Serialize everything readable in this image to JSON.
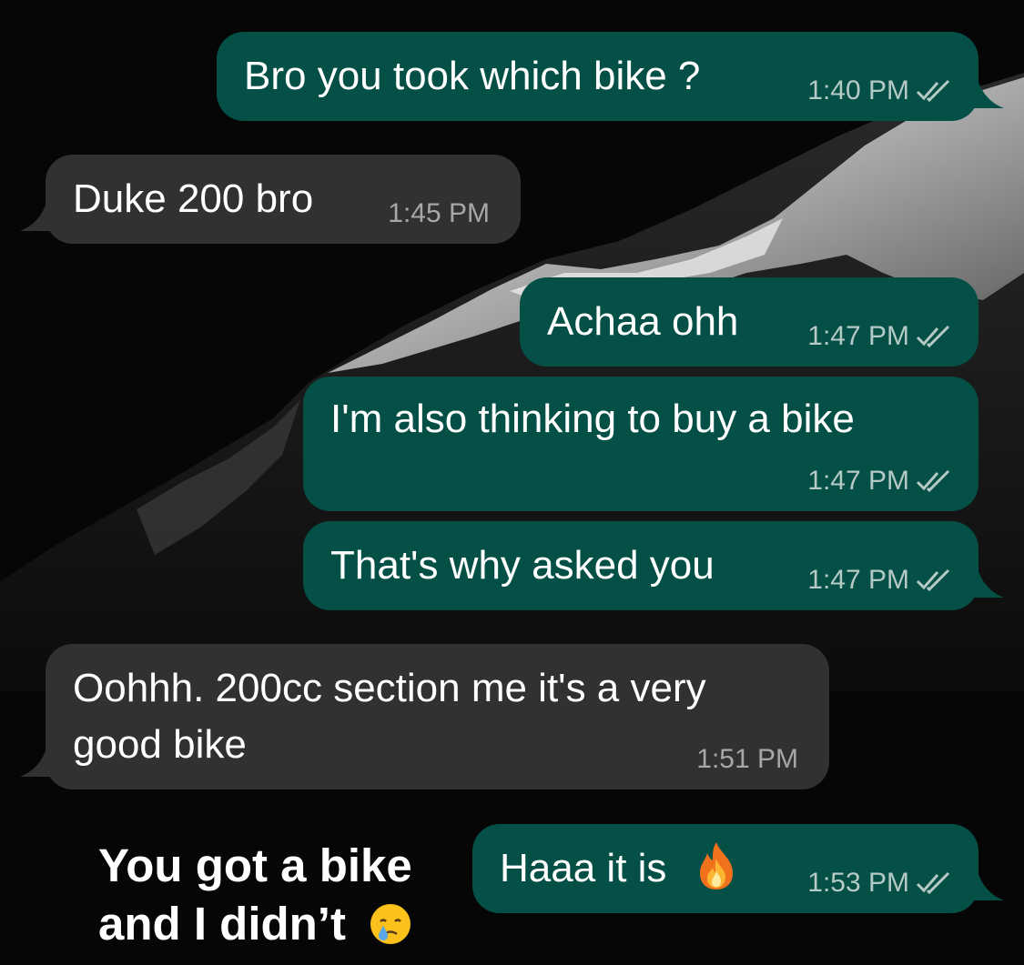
{
  "messages": [
    {
      "text": "Bro you took which bike ?",
      "time": "1:40 PM",
      "direction": "outgoing",
      "status": "read"
    },
    {
      "text": "Duke 200 bro",
      "time": "1:45 PM",
      "direction": "incoming"
    },
    {
      "text": "Achaa ohh",
      "time": "1:47 PM",
      "direction": "outgoing",
      "status": "read"
    },
    {
      "text": "I'm also thinking to buy a bike",
      "time": "1:47 PM",
      "direction": "outgoing",
      "status": "read"
    },
    {
      "text": "That's why asked you",
      "time": "1:47 PM",
      "direction": "outgoing",
      "status": "read"
    },
    {
      "text_lines": [
        "Oohhh. 200cc section me it's a very",
        "good bike"
      ],
      "time": "1:51 PM",
      "direction": "incoming"
    },
    {
      "text": "Haaa it is",
      "emoji": "fire-emoji",
      "time": "1:53 PM",
      "direction": "outgoing",
      "status": "read"
    }
  ],
  "caption": {
    "line1": "You got a bike",
    "line2": "and I didn’t",
    "emoji": "crying-face-emoji"
  },
  "colors": {
    "outgoing_bubble": "#055046",
    "incoming_bubble": "#313133",
    "background": "#060606"
  }
}
